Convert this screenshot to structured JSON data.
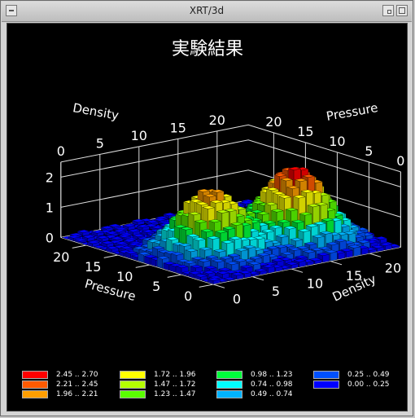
{
  "window": {
    "title": "XRT/3d"
  },
  "chart_data": {
    "type": "surface3d-bars",
    "title": "実験結果",
    "axes": {
      "back_x_label": "Density",
      "back_y_label": "Pressure",
      "front_x_label": "Pressure",
      "front_y_label": "Density",
      "density_ticks": [
        "0",
        "5",
        "10",
        "15",
        "20"
      ],
      "pressure_ticks": [
        "0",
        "5",
        "10",
        "15",
        "20"
      ],
      "z_ticks": [
        "0",
        "1",
        "2"
      ],
      "density_range": [
        0,
        24
      ],
      "pressure_range": [
        0,
        24
      ],
      "z_range": [
        0,
        2.7
      ]
    },
    "surface": {
      "description": "two Gaussian-like peaks",
      "peaks": [
        {
          "density": 17,
          "pressure": 8,
          "height": 2.45
        },
        {
          "density": 7,
          "pressure": 9,
          "height": 2.1
        }
      ]
    },
    "legend": [
      {
        "label": "2.45 .. 2.70",
        "color": "#ff0000"
      },
      {
        "label": "2.21 .. 2.45",
        "color": "#ff5a00"
      },
      {
        "label": "1.96 .. 2.21",
        "color": "#ff9e00"
      },
      {
        "label": "1.72 .. 1.96",
        "color": "#ffff00"
      },
      {
        "label": "1.47 .. 1.72",
        "color": "#b4ff00"
      },
      {
        "label": "1.23 .. 1.47",
        "color": "#5aff00"
      },
      {
        "label": "0.98 .. 1.23",
        "color": "#00ff3c"
      },
      {
        "label": "0.74 .. 0.98",
        "color": "#00ffff"
      },
      {
        "label": "0.49 .. 0.74",
        "color": "#00b4ff"
      },
      {
        "label": "0.25 .. 0.49",
        "color": "#0050ff"
      },
      {
        "label": "0.00 .. 0.25",
        "color": "#0000ff"
      }
    ]
  }
}
